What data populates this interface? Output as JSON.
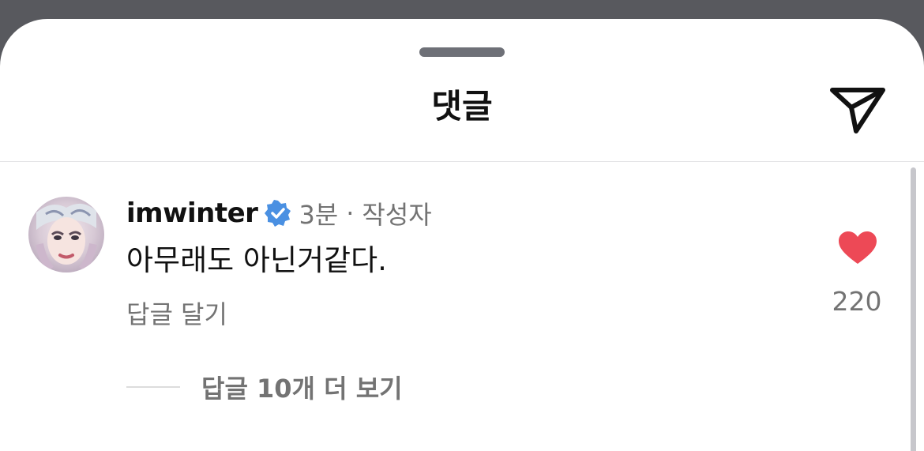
{
  "header": {
    "title": "댓글",
    "share_icon": "paper-plane-icon"
  },
  "comment": {
    "avatar_icon": "profile-photo",
    "username": "imwinter",
    "verified_icon": "verified-badge-icon",
    "verified_color": "#4a90e2",
    "time": "3분",
    "separator": "·",
    "author_tag": "작성자",
    "text": "아무래도 아닌거같다.",
    "reply_label": "답글 달기",
    "like_icon": "heart-icon",
    "like_color": "#ed4956",
    "like_count": "220",
    "view_replies_label": "답글 10개 더 보기"
  }
}
